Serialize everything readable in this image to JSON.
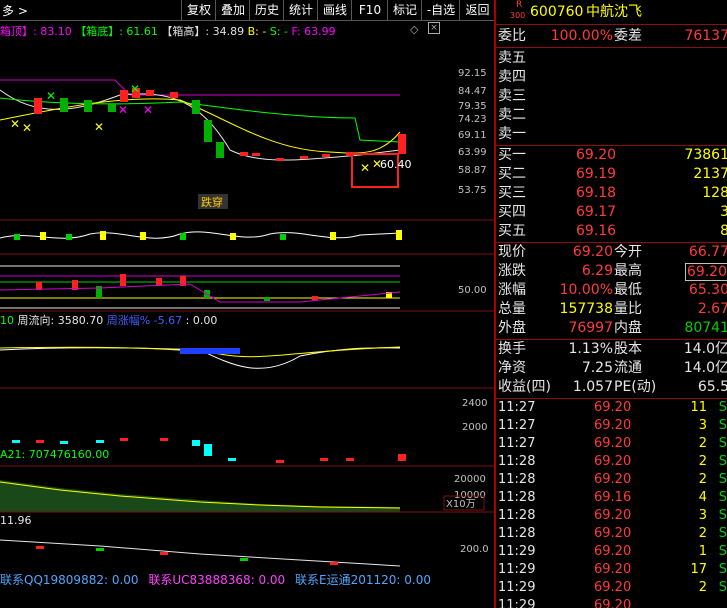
{
  "toolbar": {
    "left_label": "多 >",
    "buttons": [
      "复权",
      "叠加",
      "历史",
      "统计",
      "画线",
      "F10",
      "标记",
      "-自选",
      "返回"
    ]
  },
  "chart": {
    "legend_main": [
      {
        "text": "箱顶】: 83.10",
        "color": "#ff00ff"
      },
      {
        "text": "【箱底】: 61.61",
        "color": "#00ff00"
      },
      {
        "text": "【箱高】: 34.89",
        "color": "#e0e0e0"
      },
      {
        "text": "B: -",
        "color": "#ffff00"
      },
      {
        "text": "S: -",
        "color": "#00ff00"
      },
      {
        "text": "F: 63.99",
        "color": "#ff00ff"
      }
    ],
    "price_labels": [
      "92.15",
      "84.47",
      "79.35",
      "74.23",
      "69.11",
      "63.99",
      "58.87",
      "53.75"
    ],
    "last_price_annotation": "60.40",
    "pattern_label": "跌穿",
    "macd_level_label": "50.00",
    "flow_legend": {
      "prefix": "10",
      "label": "周流向: 3580.70",
      "label2": "周涨幅% -5.67",
      "label3": ": 0.00"
    },
    "vol_labels": [
      "2400",
      "2000"
    ],
    "amount_legend": "A21: 707476160.00",
    "amount_labels": [
      "20000",
      "10000"
    ],
    "amount_unit": "X10万",
    "bottom_legend": "11.96",
    "bottom_label": "200.0"
  },
  "status_bar": {
    "items": [
      "联系QQ19809882: 0.00",
      "联系UC83888368: 0.00",
      "联系E运通201120: 0.00"
    ]
  },
  "quote": {
    "badge_top": "R",
    "badge_bottom": "300",
    "code": "600760",
    "name": "中航沈飞",
    "weibi_label": "委比",
    "weibi_value": "100.00%",
    "weicha_label": "委差",
    "weicha_value": "76137",
    "asks": [
      {
        "label": "卖五",
        "price": "",
        "vol": ""
      },
      {
        "label": "卖四",
        "price": "",
        "vol": ""
      },
      {
        "label": "卖三",
        "price": "",
        "vol": ""
      },
      {
        "label": "卖二",
        "price": "",
        "vol": ""
      },
      {
        "label": "卖一",
        "price": "",
        "vol": ""
      }
    ],
    "bids": [
      {
        "label": "买一",
        "price": "69.20",
        "vol": "73861"
      },
      {
        "label": "买二",
        "price": "69.19",
        "vol": "2137"
      },
      {
        "label": "买三",
        "price": "69.18",
        "vol": "128"
      },
      {
        "label": "买四",
        "price": "69.17",
        "vol": "3"
      },
      {
        "label": "买五",
        "price": "69.16",
        "vol": "8"
      }
    ],
    "stats": [
      {
        "l1": "现价",
        "v1": "69.20",
        "c1": "red",
        "l2": "今开",
        "v2": "66.77",
        "c2": "red"
      },
      {
        "l1": "涨跌",
        "v1": "6.29",
        "c1": "red",
        "l2": "最高",
        "v2": "69.20",
        "c2": "red"
      },
      {
        "l1": "涨幅",
        "v1": "10.00%",
        "c1": "red",
        "l2": "最低",
        "v2": "65.30",
        "c2": "red"
      },
      {
        "l1": "总量",
        "v1": "157738",
        "c1": "yellow",
        "l2": "量比",
        "v2": "2.67",
        "c2": "red"
      },
      {
        "l1": "外盘",
        "v1": "76997",
        "c1": "red",
        "l2": "内盘",
        "v2": "80741",
        "c2": "green"
      }
    ],
    "fundamentals": [
      {
        "l1": "换手",
        "v1": "1.13%",
        "l2": "股本",
        "v2": "14.0亿"
      },
      {
        "l1": "净资",
        "v1": "7.25",
        "l2": "流通",
        "v2": "14.0亿"
      },
      {
        "l1": "收益(四)",
        "v1": "1.057",
        "l2": "PE(动)",
        "v2": "65.5"
      }
    ],
    "ticks": [
      {
        "time": "11:27",
        "price": "69.20",
        "vol": "11",
        "side": "S"
      },
      {
        "time": "11:27",
        "price": "69.20",
        "vol": "3",
        "side": "S"
      },
      {
        "time": "11:27",
        "price": "69.20",
        "vol": "2",
        "side": "S"
      },
      {
        "time": "11:28",
        "price": "69.20",
        "vol": "2",
        "side": "S"
      },
      {
        "time": "11:28",
        "price": "69.20",
        "vol": "2",
        "side": "S"
      },
      {
        "time": "11:28",
        "price": "69.16",
        "vol": "4",
        "side": "S"
      },
      {
        "time": "11:28",
        "price": "69.20",
        "vol": "3",
        "side": "S"
      },
      {
        "time": "11:28",
        "price": "69.20",
        "vol": "2",
        "side": "S"
      },
      {
        "time": "11:29",
        "price": "69.20",
        "vol": "1",
        "side": "S"
      },
      {
        "time": "11:29",
        "price": "69.20",
        "vol": "17",
        "side": "S"
      },
      {
        "time": "11:29",
        "price": "69.20",
        "vol": "2",
        "side": "S"
      },
      {
        "time": "11:29",
        "price": "69.20",
        "vol": "",
        "side": ""
      }
    ]
  }
}
